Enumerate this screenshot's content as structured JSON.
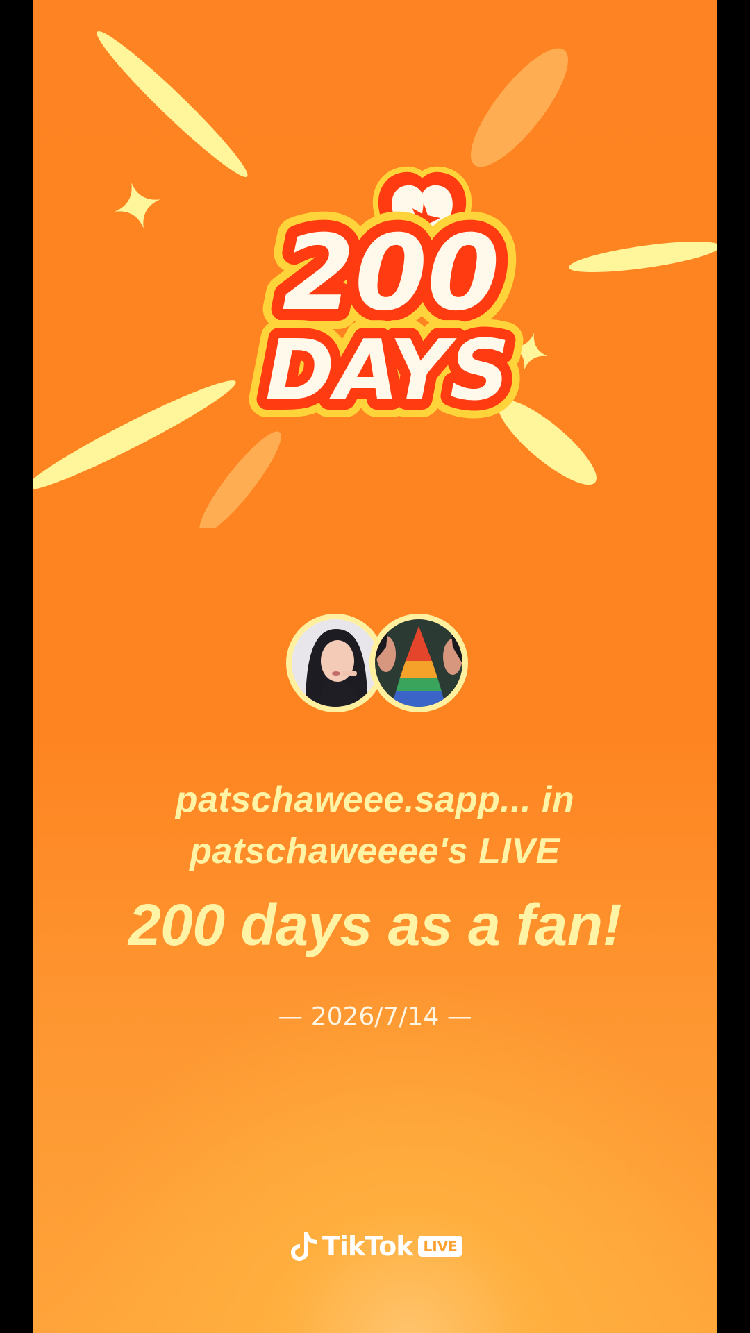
{
  "badge": {
    "number": "200",
    "word": "DAYS"
  },
  "caption": {
    "line1": "patschaweee.sapp... in",
    "line2": "patschaweeee's LIVE",
    "headline": "200 days as a fan!",
    "date": "— 2026/7/14 —"
  },
  "branding": {
    "wordmark": "TikTok",
    "badge": "LIVE",
    "icon": "tiktok-note-icon"
  },
  "avatars": [
    {
      "name": "user-avatar",
      "icon": "avatar-photo"
    },
    {
      "name": "creator-avatar",
      "icon": "avatar-photo"
    }
  ],
  "colors": {
    "background": "#fe8423",
    "text": "#fff3a6",
    "badge_red": "#ff3b12",
    "badge_yellow": "#ffd43b",
    "badge_cream": "#fff9ec"
  }
}
